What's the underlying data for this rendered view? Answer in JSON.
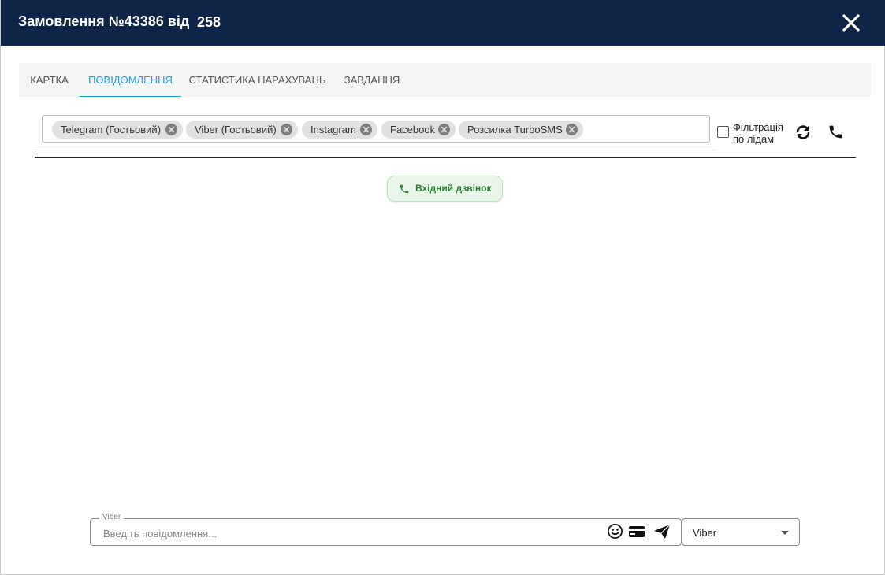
{
  "header": {
    "title": "Замовлення №43386 від",
    "number": "258"
  },
  "tabs": [
    {
      "label": "КАРТКА",
      "active": false
    },
    {
      "label": "ПОВІДОМЛЕННЯ",
      "active": true
    },
    {
      "label": "СТАТИСТИКА НАРАХУВАНЬ",
      "active": false
    },
    {
      "label": "ЗАВДАННЯ",
      "active": false
    }
  ],
  "channel_filter": {
    "chips": [
      {
        "label": "Telegram (Гостьовий)"
      },
      {
        "label": "Viber (Гостьовий)"
      },
      {
        "label": "Instagram"
      },
      {
        "label": "Facebook"
      },
      {
        "label": "Розсилка TurboSMS"
      }
    ],
    "lead_filter_label_line1": "Фільтрація",
    "lead_filter_label_line2": "по лідам",
    "lead_filter_checked": false
  },
  "events": [
    {
      "label": "Вхідний дзвінок",
      "icon": "phone-icon"
    }
  ],
  "composer": {
    "legend": "Viber",
    "placeholder": "Введіть повідомлення...",
    "channel_select_value": "Viber"
  },
  "colors": {
    "header_bg": "#0f2548",
    "active_tab": "#1ba2e0",
    "call_pill_bg": "#eaf6ea",
    "call_pill_text": "#2e7d32"
  }
}
